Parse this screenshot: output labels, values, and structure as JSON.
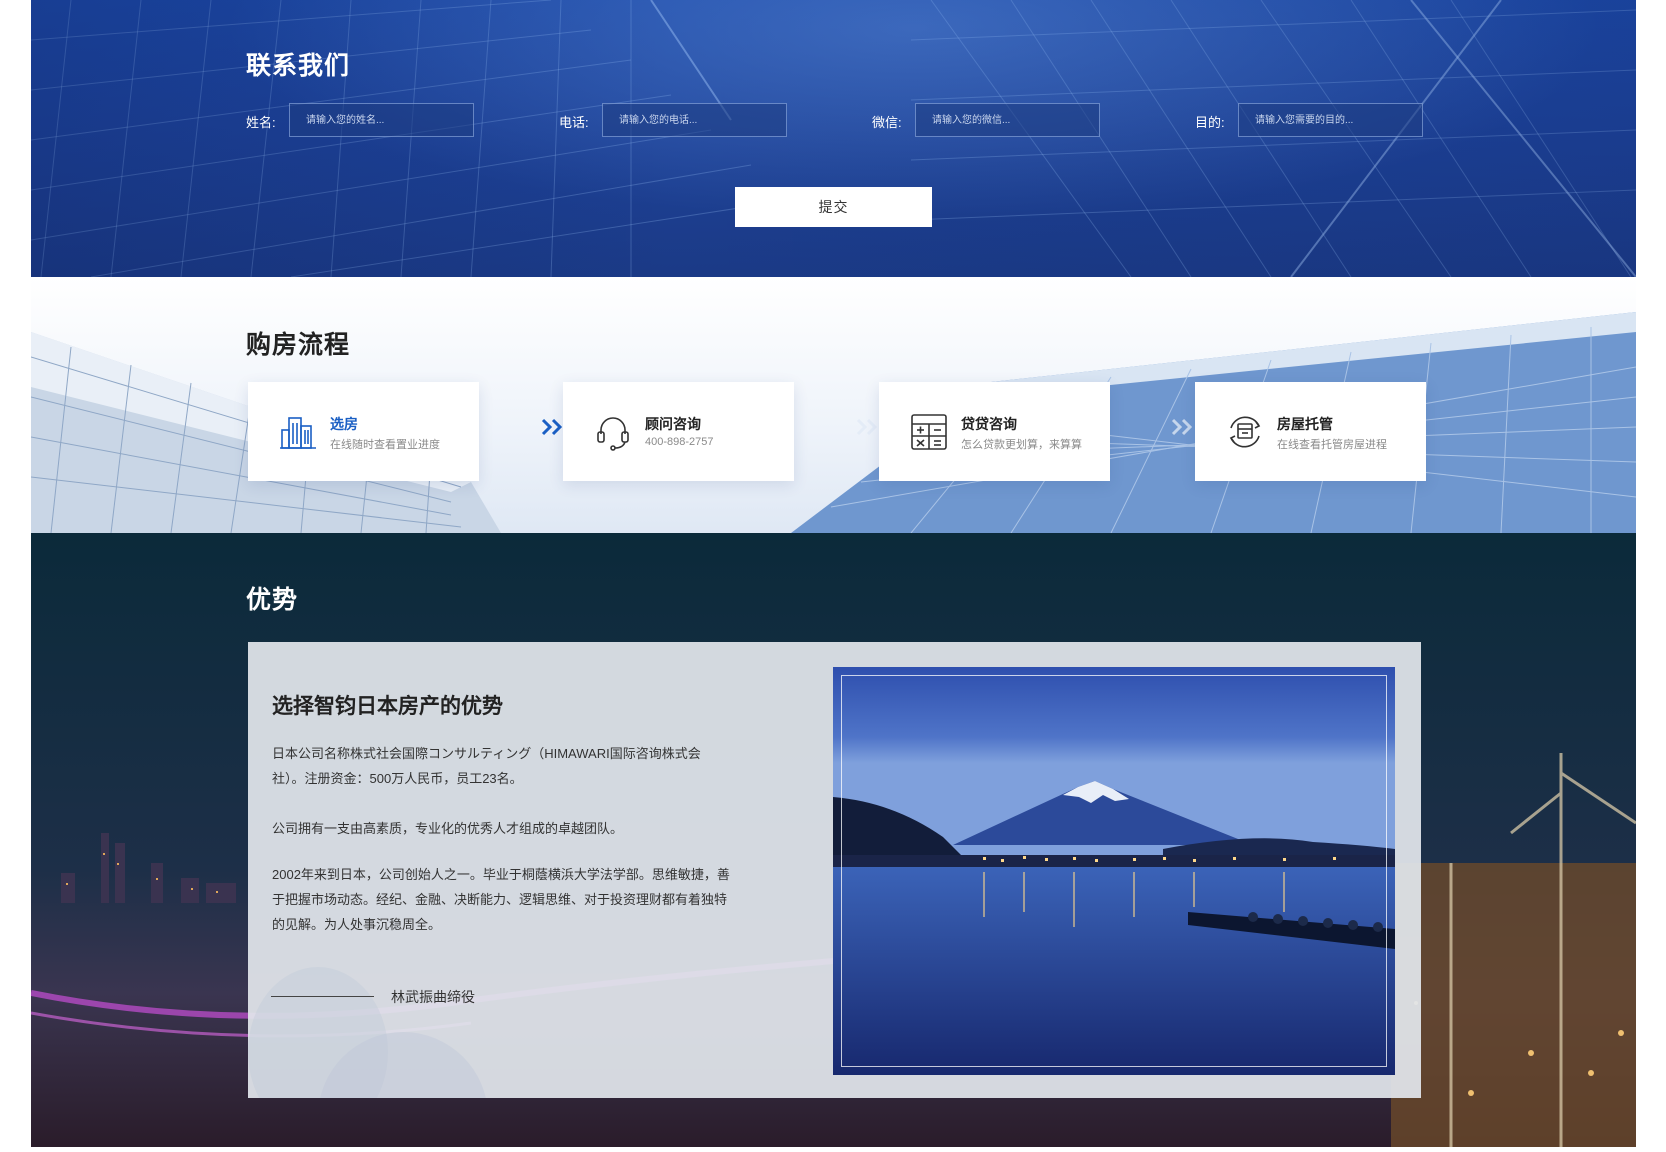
{
  "contact": {
    "title": "联系我们",
    "fields": [
      {
        "label": "姓名:",
        "placeholder": "请输入您的姓名..."
      },
      {
        "label": "电话:",
        "placeholder": "请输入您的电话..."
      },
      {
        "label": "微信:",
        "placeholder": "请输入您的微信..."
      },
      {
        "label": "目的:",
        "placeholder": "请输入您需要的目的..."
      }
    ],
    "submit_label": "提交"
  },
  "process": {
    "title": "购房流程",
    "steps": [
      {
        "title": "选房",
        "desc": "在线随时查看置业进度",
        "icon": "buildings-icon"
      },
      {
        "title": "顾问咨询",
        "desc": "400-898-2757",
        "icon": "headset-icon"
      },
      {
        "title": "贷贷咨询",
        "desc": "怎么贷款更划算，来算算",
        "icon": "calculator-icon"
      },
      {
        "title": "房屋托管",
        "desc": "在线查看托管房屋进程",
        "icon": "house-hand-icon"
      }
    ]
  },
  "advantage": {
    "title": "优势",
    "heading": "选择智钧日本房产的优势",
    "paragraphs": [
      "日本公司名称株式社会国際コンサルティング（HIMAWARI国际咨询株式会社）。注册资金：500万人民币，员工23名。",
      "公司拥有一支由高素质，专业化的优秀人才组成的卓越团队。",
      "2002年来到日本，公司创始人之一。毕业于桐蔭横浜大学法学部。思维敏捷，善于把握市场动态。经纪、金融、决断能力、逻辑思维、对于投资理财都有着独特的见解。为人处事沉稳周全。"
    ],
    "signature": "林武振曲缔役",
    "photo": "mount-fuji-lake-night-photo"
  },
  "colors": {
    "accent": "#1a5fc4",
    "contact_bg": "#1d4299",
    "advantage_bg": "#0f2a3d"
  }
}
